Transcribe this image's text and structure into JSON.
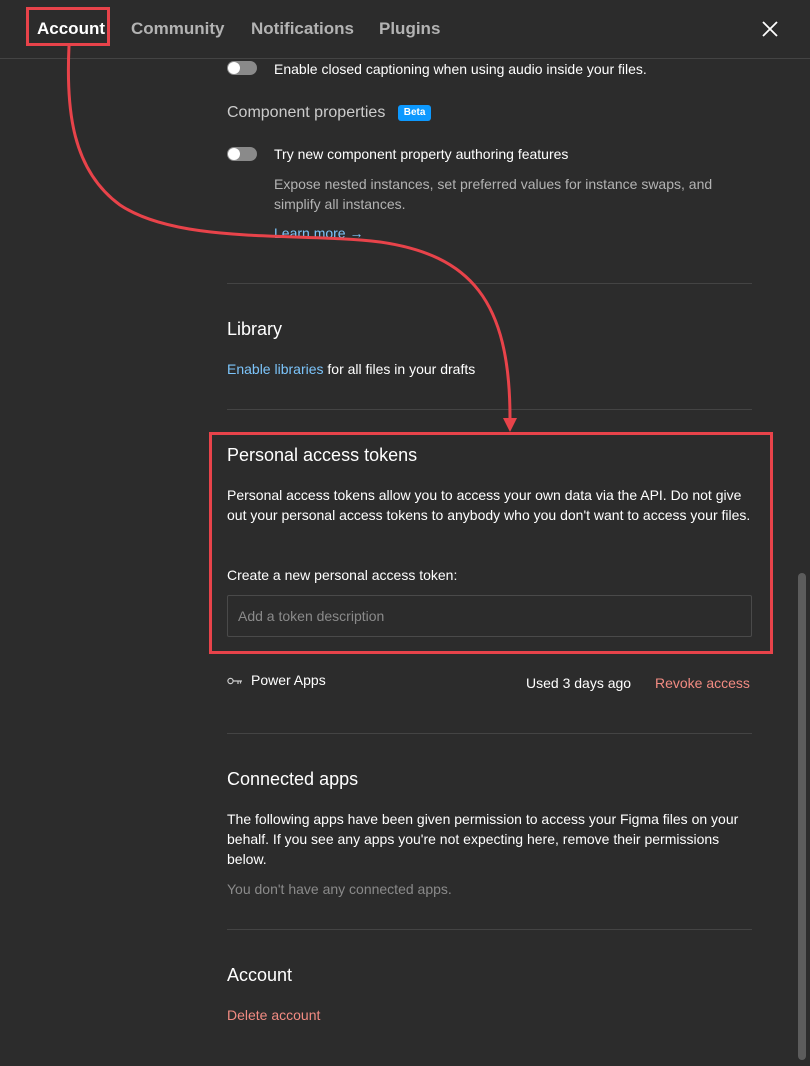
{
  "tabs": [
    {
      "label": "Account",
      "active": true
    },
    {
      "label": "Community",
      "active": false
    },
    {
      "label": "Notifications",
      "active": false
    },
    {
      "label": "Plugins",
      "active": false
    }
  ],
  "close_icon": "close-icon",
  "captioning": {
    "toggle_on": false,
    "label": "Enable closed captioning when using audio inside your files."
  },
  "component_properties": {
    "title": "Component properties",
    "badge": "Beta",
    "toggle_on": false,
    "label": "Try new component property authoring features",
    "description": "Expose nested instances, set preferred values for instance swaps, and simplify all instances.",
    "learn_more": "Learn more →"
  },
  "library": {
    "title": "Library",
    "link": "Enable libraries",
    "suffix": " for all files in your drafts"
  },
  "personal_access_tokens": {
    "title": "Personal access tokens",
    "description": "Personal access tokens allow you to access your own data via the API. Do not give out your personal access tokens to anybody who you don't want to access your files.",
    "create_label": "Create a new personal access token:",
    "input_placeholder": "Add a token description",
    "token": {
      "icon": "key-icon",
      "name": "Power Apps",
      "used": "Used 3 days ago",
      "revoke": "Revoke access"
    }
  },
  "connected_apps": {
    "title": "Connected apps",
    "description": "The following apps have been given permission to access your Figma files on your behalf. If you see any apps you're not expecting here, remove their permissions below.",
    "empty": "You don't have any connected apps."
  },
  "account": {
    "title": "Account",
    "delete": "Delete account"
  },
  "colors": {
    "background": "#2c2c2c",
    "accent_blue": "#0d99ff",
    "link_blue": "#7cc4fa",
    "danger_red": "#f28b82",
    "annotation_red": "#e8434a"
  }
}
